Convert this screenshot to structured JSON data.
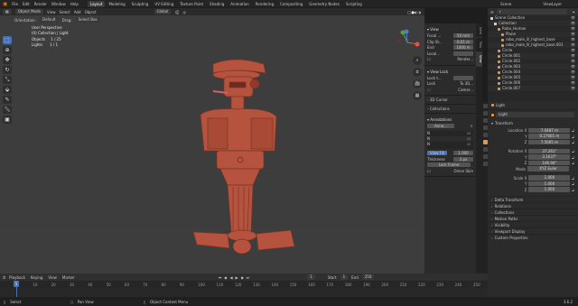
{
  "topbar": {
    "menu": [
      "File",
      "Edit",
      "Render",
      "Window",
      "Help"
    ],
    "workspaces": [
      "Layout",
      "Modeling",
      "Sculpting",
      "UV Editing",
      "Texture Paint",
      "Shading",
      "Animation",
      "Rendering",
      "Compositing",
      "Geometry Nodes",
      "Scripting"
    ],
    "scene_label": "Scene",
    "viewlayer_label": "ViewLayer"
  },
  "viewport_header": {
    "mode": "Object Mode",
    "menu": [
      "View",
      "Select",
      "Add",
      "Object"
    ],
    "orientation_label": "Orientation:",
    "orientation": "Default",
    "drag_label": "Drag:",
    "drag": "Select Box",
    "transform": "Global"
  },
  "viewport": {
    "perspective": "User Perspective",
    "collection": "(0) Collection | Light",
    "objects_label": "Objects",
    "objects_value": "1 / 25",
    "lights_label": "Lights",
    "lights_value": "1 / 1"
  },
  "npanel": {
    "tabs": [
      "Item",
      "Tool",
      "View"
    ],
    "view_title": "View",
    "focal_label": "Focal ...",
    "focal_value": "50 mm",
    "clip_start_label": "Clip St...",
    "clip_start_value": "0.01 m",
    "end_label": "End",
    "end_value": "1000 m",
    "local_camera": "Local...",
    "render_region": "Render...",
    "view_lock_title": "View Lock",
    "lock_to_object": "Lock t...",
    "lock_label": "Lock",
    "lock_value": "To 3D...",
    "camera_lock": "Camer...",
    "cursor_title": "3D Cursor",
    "collections_title": "Collections",
    "annotations_title": "Annotations",
    "annotation_layer": "Anno...",
    "view_fill": "View Fill",
    "view_fill_value": "1.000",
    "thickness_label": "Thickness",
    "thickness_value": "3 px",
    "lock_frame": "Lock Frame",
    "onion_skin": "Onion Skin"
  },
  "outliner": {
    "search_placeholder": "",
    "items": [
      {
        "name": "Scene Collection",
        "type": "col",
        "depth": 0
      },
      {
        "name": "Collection",
        "type": "col",
        "depth": 1
      },
      {
        "name": "Robo_Human",
        "type": "obj",
        "depth": 2
      },
      {
        "name": "Plane",
        "type": "obj",
        "depth": 3
      },
      {
        "name": "robo_male_lil_highest_base",
        "type": "obj",
        "depth": 3
      },
      {
        "name": "robo_male_lil_highest_base.001",
        "type": "obj",
        "depth": 3
      },
      {
        "name": "Circle",
        "type": "obj",
        "depth": 2
      },
      {
        "name": "Circle.001",
        "type": "obj",
        "depth": 2
      },
      {
        "name": "Circle.002",
        "type": "obj",
        "depth": 2
      },
      {
        "name": "Circle.003",
        "type": "obj",
        "depth": 2
      },
      {
        "name": "Circle.004",
        "type": "obj",
        "depth": 2
      },
      {
        "name": "Circle.005",
        "type": "obj",
        "depth": 2
      },
      {
        "name": "Circle.006",
        "type": "obj",
        "depth": 2
      },
      {
        "name": "Circle.007",
        "type": "obj",
        "depth": 2
      }
    ]
  },
  "properties": {
    "breadcrumb": "Light",
    "object_name": "Light",
    "transform_title": "Transform",
    "location_label": "Location X",
    "location": [
      "7.0487 m",
      "0.27665 m",
      "7.5065 m"
    ],
    "rotation_label": "Rotation X",
    "rotation": [
      "37.261°",
      "3.1637°",
      "106.94°"
    ],
    "mode_label": "Mode",
    "mode_value": "XYZ Euler",
    "scale_label": "Scale X",
    "scale": [
      "1.000",
      "1.000",
      "1.000"
    ],
    "y_label": "Y",
    "z_label": "Z",
    "sections": [
      "Delta Transform",
      "Relations",
      "Collections",
      "Motion Paths",
      "Visibility",
      "Viewport Display",
      "Custom Properties"
    ]
  },
  "timeline": {
    "menu": [
      "Playback",
      "Keying",
      "View",
      "Marker"
    ],
    "current_frame": "1",
    "start_label": "Start",
    "start_value": "1",
    "end_label": "End",
    "end_value": "250",
    "ticks": [
      "0",
      "10",
      "20",
      "30",
      "40",
      "50",
      "60",
      "70",
      "80",
      "90",
      "100",
      "110",
      "120",
      "130",
      "140",
      "150",
      "160",
      "170",
      "180",
      "190",
      "200",
      "210",
      "220",
      "230",
      "240",
      "250"
    ]
  },
  "statusbar": {
    "select": "Select",
    "pan_view": "Pan View",
    "context_menu": "Object Context Menu",
    "version": "3.6.2"
  },
  "colors": {
    "accent": "#4772b3",
    "object": "#e59a42",
    "model": "#b5533e"
  }
}
